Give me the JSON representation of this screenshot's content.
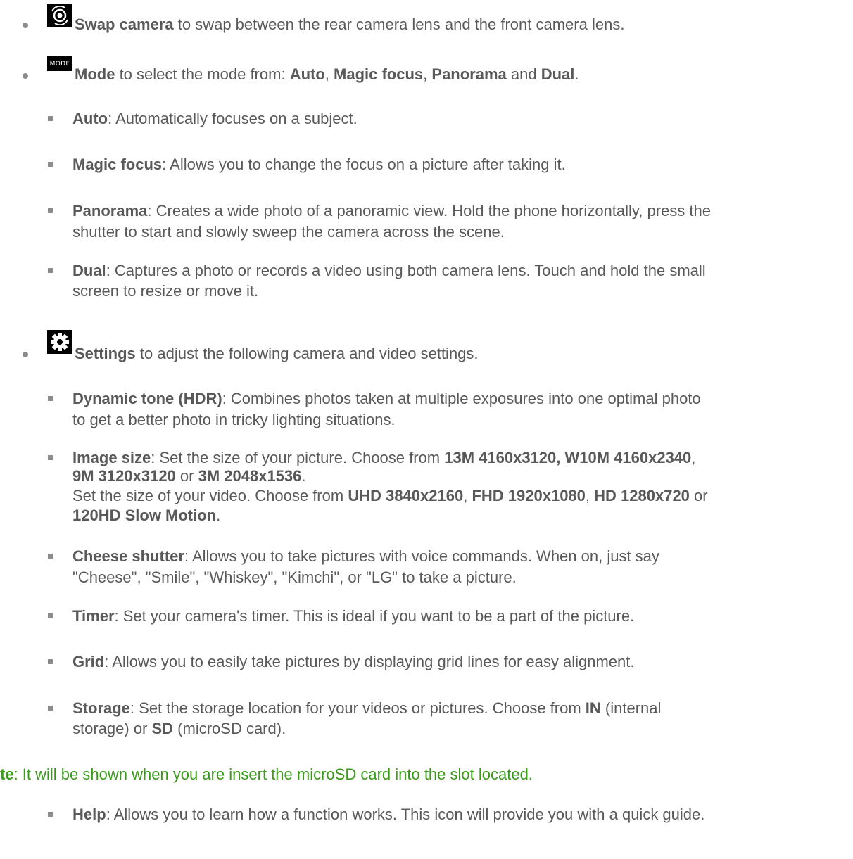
{
  "items": {
    "swap": {
      "icon": "swap-camera-icon",
      "label": "Swap camera",
      "text": " to swap between the rear camera lens and the front camera lens."
    },
    "mode": {
      "icon_text": "MODE",
      "label": "Mode",
      "text_a": " to select the mode from: ",
      "m1": "Auto",
      "sep1": ", ",
      "m2": "Magic focus",
      "sep2": ", ",
      "m3": "Panorama",
      "sep3": " and ",
      "m4": "Dual",
      "end": ".",
      "subs": [
        {
          "term": "Auto",
          "text": ": Automatically focuses on a subject."
        },
        {
          "term": "Magic focus",
          "text": ": Allows you to change the focus on a picture after taking it."
        },
        {
          "term": "Panorama",
          "text": ": Creates a wide photo of a panoramic view. Hold the phone horizontally, press the",
          "text2": "shutter to start and slowly sweep the camera across the scene."
        },
        {
          "term": "Dual",
          "text": ": Captures a photo or records a video using both camera lens. Touch and hold the small",
          "text2": "screen to resize or move it."
        }
      ]
    },
    "settings": {
      "icon": "gear-icon",
      "label": "Settings",
      "text": " to adjust the following camera and video settings.",
      "hdr": {
        "term": "Dynamic tone (HDR)",
        "text": ": Combines photos taken at multiple exposures into one optimal photo",
        "text2": "to get a better photo in tricky lighting situations."
      },
      "image_size": {
        "term": "Image size",
        "t1": ": Set the size of your picture. Choose from ",
        "b1": "13M 4160x3120, W10M 4160x2340",
        "s1": ",",
        "b2": "9M 3120x3120",
        "s2": " or ",
        "b3": "3M 2048x1536",
        "s3": ".",
        "t2": "Set the size of your video. Choose from ",
        "b4": "UHD 3840x2160",
        "s4": ", ",
        "b5": "FHD 1920x1080",
        "s5": ", ",
        "b6": "HD 1280x720",
        "s6": " or",
        "b7": "120HD Slow Motion",
        "s7": "."
      },
      "cheese": {
        "term": "Cheese shutter",
        "text": ": Allows you to take pictures with voice commands. When on, just say",
        "text2": "\"Cheese\", \"Smile\", \"Whiskey\", \"Kimchi\", or \"LG\" to take a picture."
      },
      "timer": {
        "term": "Timer",
        "text": ": Set your camera's timer. This is ideal if you want to be a part of the picture."
      },
      "grid": {
        "term": "Grid",
        "text": ": Allows you to easily take pictures by displaying grid lines for easy alignment."
      },
      "storage": {
        "term": "Storage",
        "t1": ": Set the storage location for your videos or pictures. Choose from ",
        "b1": "IN",
        "t2": " (internal",
        "t3": "storage) or ",
        "b2": "SD",
        "t4": " (microSD card)."
      },
      "note": {
        "term": "te",
        "text": ": It will be shown when you are insert the microSD card into the slot located."
      },
      "help": {
        "term": "Help",
        "text": ": Allows you to learn how a function works. This icon will provide you with a quick guide."
      }
    }
  },
  "colors": {
    "text": "#595959",
    "note": "#3a9a1a",
    "bullet": "#8c8c8c"
  }
}
